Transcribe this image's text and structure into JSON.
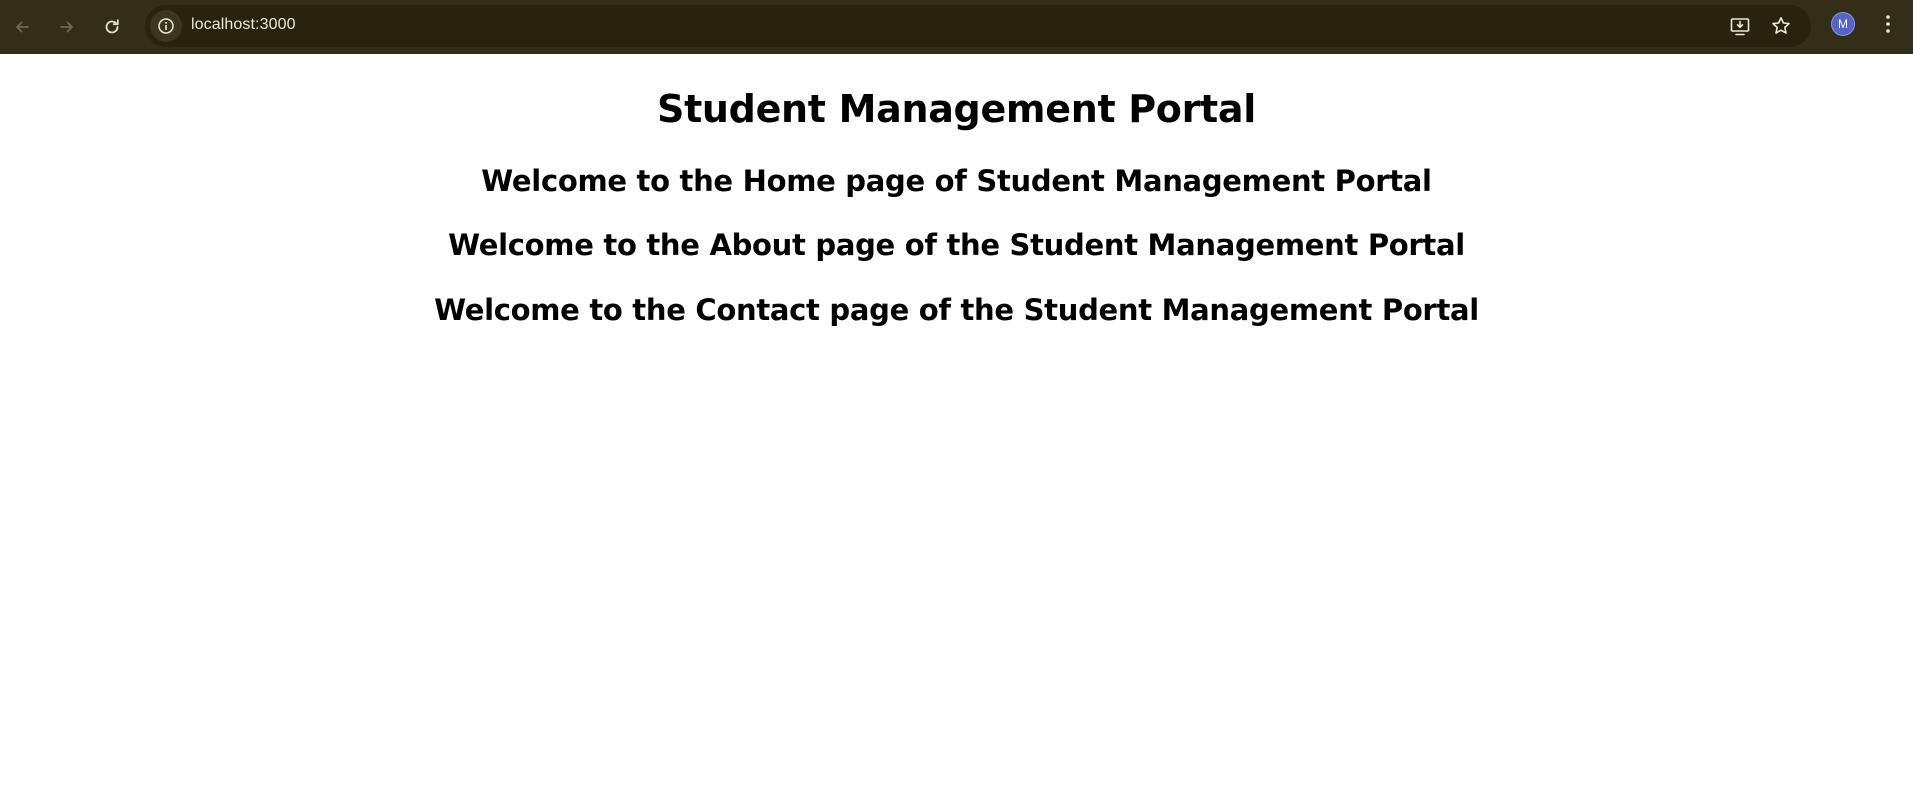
{
  "browser": {
    "url": "localhost:3000",
    "avatar_initial": "M",
    "toolbar_color": "#332e18",
    "icons": [
      "back-arrow-icon",
      "forward-arrow-icon",
      "reload-icon",
      "site-info-icon",
      "install-app-icon",
      "bookmark-star-icon",
      "kebab-menu-icon"
    ]
  },
  "page": {
    "title": "Student Management Portal",
    "home_heading": "Welcome to the Home page of Student Management Portal",
    "about_heading": "Welcome to the About page of the Student Management Portal",
    "contact_heading": "Welcome to the Contact page of the Student Management Portal"
  }
}
